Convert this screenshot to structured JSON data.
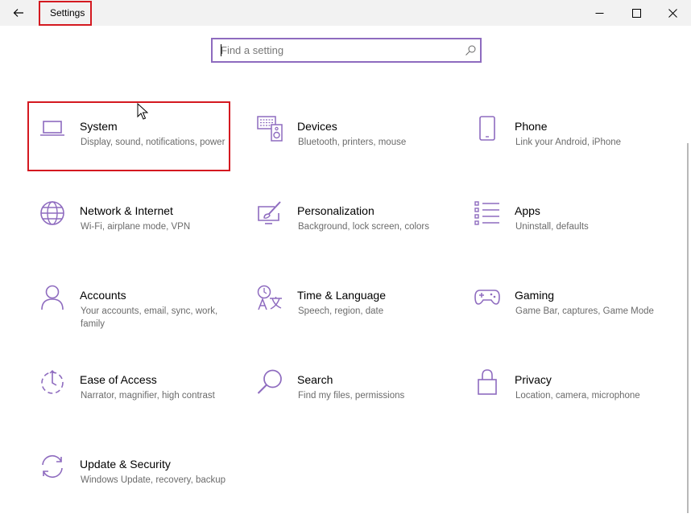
{
  "window": {
    "title": "Settings",
    "accent_color": "#8e6bbf",
    "highlight_color": "#d41920"
  },
  "search": {
    "placeholder": "Find a setting",
    "value": ""
  },
  "categories": [
    {
      "name": "System",
      "desc": "Display, sound, notifications, power",
      "icon": "laptop-icon"
    },
    {
      "name": "Devices",
      "desc": "Bluetooth, printers, mouse",
      "icon": "keyboard-speaker-icon"
    },
    {
      "name": "Phone",
      "desc": "Link your Android, iPhone",
      "icon": "phone-icon"
    },
    {
      "name": "Network & Internet",
      "desc": "Wi-Fi, airplane mode, VPN",
      "icon": "globe-icon"
    },
    {
      "name": "Personalization",
      "desc": "Background, lock screen, colors",
      "icon": "paintbrush-icon"
    },
    {
      "name": "Apps",
      "desc": "Uninstall, defaults",
      "icon": "apps-list-icon"
    },
    {
      "name": "Accounts",
      "desc": "Your accounts, email, sync, work, family",
      "icon": "person-icon"
    },
    {
      "name": "Time & Language",
      "desc": "Speech, region, date",
      "icon": "time-language-icon"
    },
    {
      "name": "Gaming",
      "desc": "Game Bar, captures, Game Mode",
      "icon": "gamepad-icon"
    },
    {
      "name": "Ease of Access",
      "desc": "Narrator, magnifier, high contrast",
      "icon": "ease-of-access-icon"
    },
    {
      "name": "Search",
      "desc": "Find my files, permissions",
      "icon": "magnifier-icon"
    },
    {
      "name": "Privacy",
      "desc": "Location, camera, microphone",
      "icon": "lock-icon"
    },
    {
      "name": "Update & Security",
      "desc": "Windows Update, recovery, backup",
      "icon": "sync-arrows-icon"
    }
  ]
}
